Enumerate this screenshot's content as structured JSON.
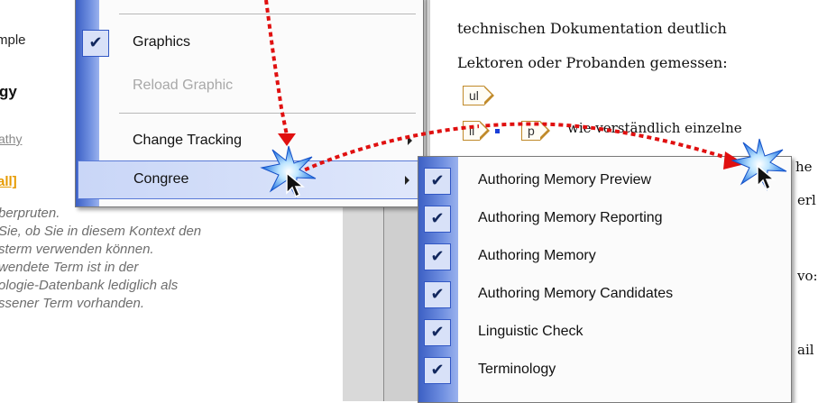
{
  "left_pane": {
    "example": "mple",
    "bold_text": "gy",
    "link_text": "athy",
    "all_link": "all]",
    "description_lines": [
      "berpruten.",
      "Sie, ob Sie in diesem Kontext den",
      "sterm verwenden können.",
      "wendete Term ist in der",
      "ologie-Datenbank lediglich als",
      "ssener Term vorhanden."
    ]
  },
  "document": {
    "line1": "technischen Dokumentation deutlich",
    "line2": "Lektoren oder Probanden gemessen:",
    "tag_ul": "ul",
    "tag_li": "li",
    "tag_p": "p",
    "line3": "wie verständlich einzelne",
    "fragments": [
      "he",
      "erl",
      "vo:",
      "ail"
    ]
  },
  "main_menu": {
    "items": [
      {
        "label": "Graphics",
        "checked": true
      },
      {
        "label": "Reload Graphic",
        "disabled": true
      },
      {
        "label": "Change Tracking",
        "submenu": true
      },
      {
        "label": "Congree",
        "submenu": true,
        "highlighted": true
      }
    ]
  },
  "congree_submenu": {
    "items": [
      {
        "label": "Authoring Memory Preview",
        "checked": true
      },
      {
        "label": "Authoring Memory Reporting",
        "checked": true
      },
      {
        "label": "Authoring Memory",
        "checked": true
      },
      {
        "label": "Authoring Memory Candidates",
        "checked": true
      },
      {
        "label": "Linguistic Check",
        "checked": true
      },
      {
        "label": "Terminology",
        "checked": true
      }
    ]
  },
  "check_glyph": "✔",
  "annotation_color": "#e01010"
}
